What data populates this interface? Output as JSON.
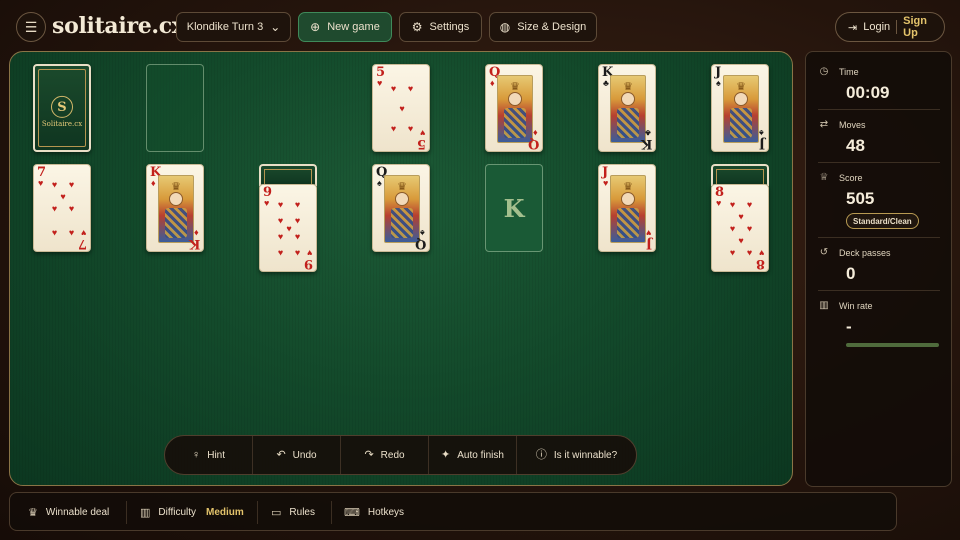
{
  "brand": "solitaire.cx",
  "toolbar": {
    "variant": "Klondike Turn 3",
    "new_game": "New game",
    "settings": "Settings",
    "size_design": "Size & Design"
  },
  "auth": {
    "login": "Login",
    "signup": "Sign Up"
  },
  "icons": {
    "menu": "hamburger-icon",
    "chevron": "chevron-down-icon",
    "new_game": "plus-circle-icon",
    "settings": "gear-icon",
    "palette": "palette-icon",
    "login": "login-icon"
  },
  "stock": {
    "back_logo": "S",
    "back_text": "Solitaire.cx"
  },
  "foundations": [
    {
      "rank": "5",
      "suit": "♥",
      "color": "red",
      "type": "pips"
    },
    {
      "rank": "Q",
      "suit": "♦",
      "color": "red",
      "type": "face"
    },
    {
      "rank": "K",
      "suit": "♣",
      "color": "black",
      "type": "face"
    },
    {
      "rank": "J",
      "suit": "♠",
      "color": "black",
      "type": "face"
    }
  ],
  "tableau": [
    {
      "hidden": 0,
      "top": {
        "rank": "7",
        "suit": "♥",
        "color": "red",
        "type": "pips"
      }
    },
    {
      "hidden": 0,
      "top": {
        "rank": "K",
        "suit": "♦",
        "color": "red",
        "type": "face"
      }
    },
    {
      "hidden": 1,
      "top": {
        "rank": "9",
        "suit": "♥",
        "color": "red",
        "type": "pips"
      }
    },
    {
      "hidden": 0,
      "top": {
        "rank": "Q",
        "suit": "♠",
        "color": "black",
        "type": "face"
      }
    },
    {
      "empty": true,
      "placeholder": "K"
    },
    {
      "hidden": 0,
      "top": {
        "rank": "J",
        "suit": "♥",
        "color": "red",
        "type": "face"
      }
    },
    {
      "hidden": 1,
      "top": {
        "rank": "8",
        "suit": "♥",
        "color": "red",
        "type": "pips"
      }
    }
  ],
  "actions": [
    {
      "label": "Hint",
      "icon": "lightbulb-icon"
    },
    {
      "label": "Undo",
      "icon": "undo-icon"
    },
    {
      "label": "Redo",
      "icon": "redo-icon"
    },
    {
      "label": "Auto finish",
      "icon": "sparkles-icon"
    },
    {
      "label": "Is it winnable?",
      "icon": "info-icon"
    }
  ],
  "stats": {
    "time": {
      "label": "Time",
      "value": "00:09"
    },
    "moves": {
      "label": "Moves",
      "value": "48"
    },
    "score": {
      "label": "Score",
      "value": "505",
      "badge": "Standard/Clean"
    },
    "deck_passes": {
      "label": "Deck passes",
      "value": "0"
    },
    "win_rate": {
      "label": "Win rate",
      "value": "-"
    }
  },
  "bottom": {
    "winnable": "Winnable deal",
    "difficulty_label": "Difficulty",
    "difficulty_value": "Medium",
    "rules": "Rules",
    "hotkeys": "Hotkeys"
  },
  "colors": {
    "felt": "#134a2b",
    "accent_gold": "#e3c36b",
    "card_red": "#c2201c",
    "card_black": "#1b1b1b"
  }
}
